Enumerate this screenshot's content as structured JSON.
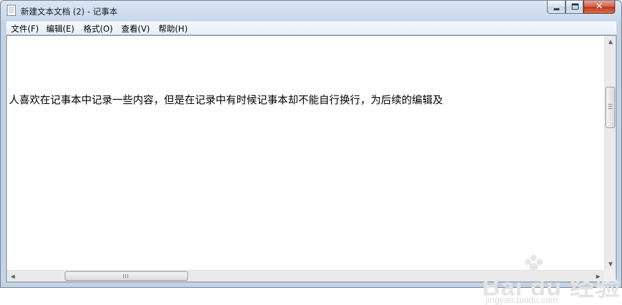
{
  "window": {
    "title": "新建文本文档 (2) - 记事本",
    "app_icon": "notepad-icon",
    "controls": {
      "minimize_icon": "minimize-icon",
      "maximize_icon": "maximize-icon",
      "close_icon": "close-icon",
      "close_glyph": "✕"
    }
  },
  "menubar": {
    "items": [
      {
        "label": "文件(F)"
      },
      {
        "label": "编辑(E)"
      },
      {
        "label": "格式(O)"
      },
      {
        "label": "查看(V)"
      },
      {
        "label": "帮助(H)"
      }
    ]
  },
  "editor": {
    "content": "人喜欢在记事本中记录一些内容，但是在记录中有时候记事本却不能自行换行，为后续的编辑及"
  },
  "scrollbars": {
    "up_arrow": "▲",
    "down_arrow": "▼",
    "left_arrow": "◀",
    "right_arrow": "▶"
  },
  "watermark": {
    "brand": "Bai du 经验",
    "url": "jingyan.baidu.com"
  },
  "colors": {
    "title_bar": "#c9d8ea",
    "close_button": "#c0391d",
    "editor_background": "#ffffff"
  }
}
